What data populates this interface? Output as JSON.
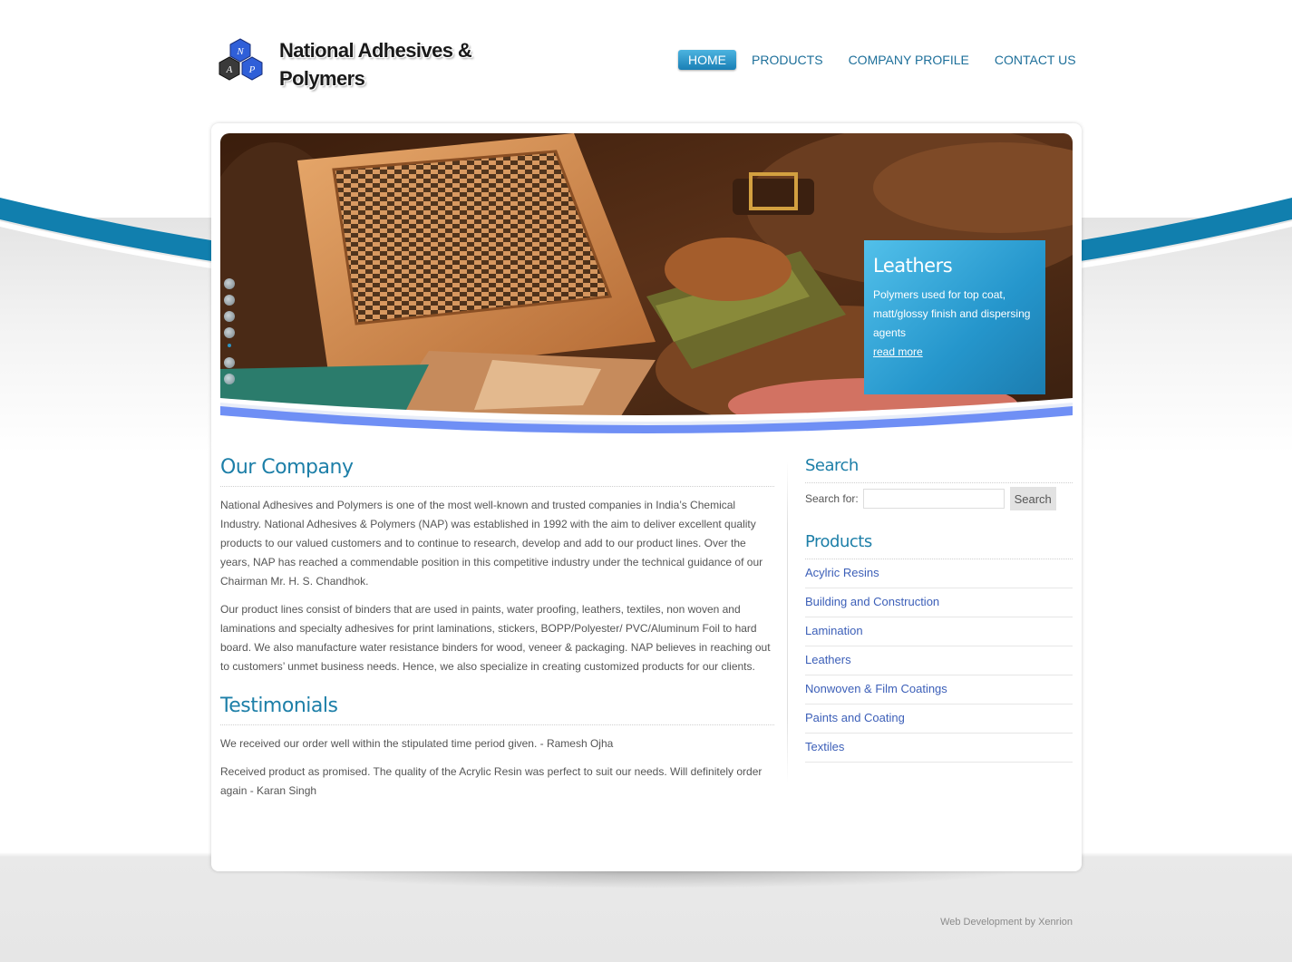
{
  "brand": {
    "logo_letters": [
      "N",
      "A",
      "P"
    ],
    "name": "National Adhesives & Polymers"
  },
  "nav": {
    "items": [
      "HOME",
      "PRODUCTS",
      "COMPANY PROFILE",
      "CONTACT US"
    ],
    "active": "HOME"
  },
  "slider": {
    "caption_title": "Leathers",
    "caption_text": "Polymers used for top coat, matt/glossy finish and dispersing agents",
    "read_more": "read more"
  },
  "company": {
    "title": "Our Company",
    "paragraphs": [
      "National Adhesives and Polymers is one of the most well-known and trusted companies in India’s Chemical Industry. National Adhesives & Polymers (NAP) was established in 1992 with the aim to deliver excellent quality products to our valued customers and to continue to research, develop and add to our product lines. Over the years, NAP has reached a commendable position in this competitive industry under the technical guidance of our Chairman Mr. H. S. Chandhok.",
      "Our product lines consist of binders that are used in paints, water proofing, leathers, textiles, non woven and laminations and specialty adhesives for print laminations, stickers, BOPP/Polyester/ PVC/Aluminum Foil to hard board. We also manufacture water resistance binders for wood, veneer & packaging. NAP believes in reaching out to customers’ unmet business needs. Hence, we also specialize in creating customized products for our clients."
    ]
  },
  "testimonials": {
    "title": "Testimonials",
    "items": [
      "We received our order well within the stipulated time period given. - Ramesh Ojha",
      "Received product as promised. The quality of the Acrylic Resin was perfect to suit our needs. Will definitely order again - Karan Singh"
    ]
  },
  "search": {
    "title": "Search",
    "label": "Search for:",
    "value": "",
    "button": "Search"
  },
  "products": {
    "title": "Products",
    "items": [
      "Acylric Resins",
      "Building and Construction",
      "Lamination",
      "Leathers",
      "Nonwoven & Film Coatings",
      "Paints and Coating",
      "Textiles"
    ]
  },
  "footer": {
    "credit": "Web Development by Xenrion"
  },
  "colors": {
    "accent": "#1d7fa8",
    "nav_active": "#1a7fb5",
    "link": "#3c5fb8",
    "swoosh": "#117fae"
  }
}
